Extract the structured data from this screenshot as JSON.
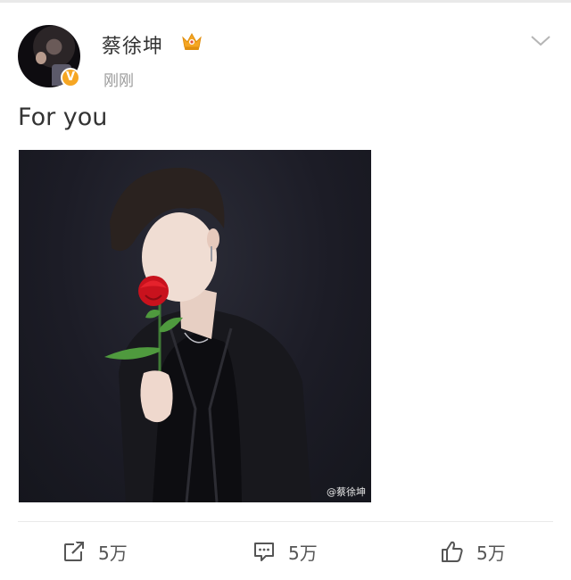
{
  "post": {
    "username": "蔡徐坤",
    "timestamp": "刚刚",
    "verified_badge": "V",
    "crown_icon": "crown-icon",
    "text": "For you",
    "image_watermark": "@蔡徐坤"
  },
  "actions": {
    "repost": {
      "icon": "share-icon",
      "count": "5万"
    },
    "comment": {
      "icon": "comment-icon",
      "count": "5万"
    },
    "like": {
      "icon": "thumbs-up-icon",
      "count": "5万"
    }
  },
  "colors": {
    "text_primary": "#333333",
    "text_secondary": "#999999",
    "badge": "#f6a623",
    "crown": "#f5a623"
  }
}
